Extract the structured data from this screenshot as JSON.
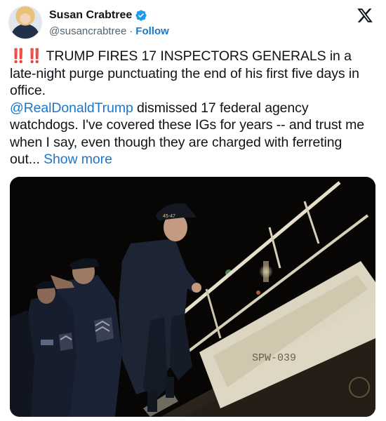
{
  "author": {
    "display_name": "Susan Crabtree",
    "handle": "@susancrabtree",
    "separator": "·",
    "follow_label": "Follow"
  },
  "icons": {
    "verified": "verified-badge-icon",
    "platform": "x-logo-icon",
    "alert": "double-exclamation-icon"
  },
  "tweet": {
    "alert_glyph": "‼️",
    "line1_text": "TRUMP FIRES 17 INSPECTORS GENERALS in a late-night purge punctuating the end of his first five days in office.",
    "mention": "@RealDonaldTrump",
    "line2_text": " dismissed 17 federal agency watchdogs. I've covered these IGs for years -- and trust me when I say, even though they are charged with ferreting out... ",
    "show_more_label": "Show more"
  },
  "media": {
    "hat_text": "45-47",
    "stairs_text": "SPW-039"
  },
  "colors": {
    "link": "#1d77c8",
    "verified": "#1d9bf0",
    "text": "#0f1419",
    "muted": "#536471",
    "alert": "#d71920"
  }
}
